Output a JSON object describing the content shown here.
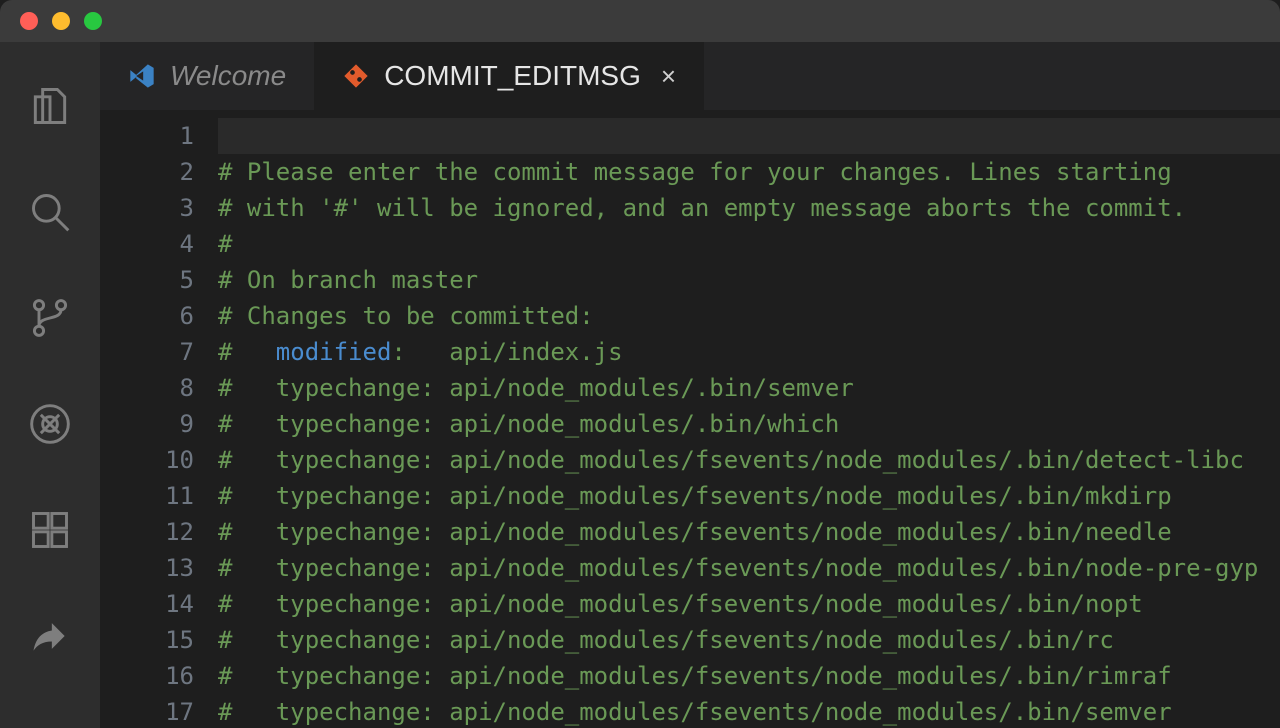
{
  "tabs": {
    "welcome": {
      "label": "Welcome"
    },
    "commit": {
      "label": "COMMIT_EDITMSG",
      "close": "×"
    }
  },
  "lineNumbers": [
    "1",
    "2",
    "3",
    "4",
    "5",
    "6",
    "7",
    "8",
    "9",
    "10",
    "11",
    "12",
    "13",
    "14",
    "15",
    "16",
    "17"
  ],
  "lines": [
    {
      "segments": [
        {
          "cls": "tok-default",
          "text": ""
        }
      ],
      "cursor": true
    },
    {
      "segments": [
        {
          "cls": "tok-comment",
          "text": "# Please enter the commit message for your changes. Lines starting"
        }
      ]
    },
    {
      "segments": [
        {
          "cls": "tok-comment",
          "text": "# with '#' will be ignored, and an empty message aborts the commit."
        }
      ]
    },
    {
      "segments": [
        {
          "cls": "tok-comment",
          "text": "#"
        }
      ]
    },
    {
      "segments": [
        {
          "cls": "tok-comment",
          "text": "# On branch master"
        }
      ]
    },
    {
      "segments": [
        {
          "cls": "tok-comment",
          "text": "# Changes to be committed:"
        }
      ]
    },
    {
      "segments": [
        {
          "cls": "tok-comment",
          "text": "#   "
        },
        {
          "cls": "tok-keyword",
          "text": "modified"
        },
        {
          "cls": "tok-comment",
          "text": ":   api/index.js"
        }
      ]
    },
    {
      "segments": [
        {
          "cls": "tok-comment",
          "text": "#   typechange: api/node_modules/.bin/semver"
        }
      ]
    },
    {
      "segments": [
        {
          "cls": "tok-comment",
          "text": "#   typechange: api/node_modules/.bin/which"
        }
      ]
    },
    {
      "segments": [
        {
          "cls": "tok-comment",
          "text": "#   typechange: api/node_modules/fsevents/node_modules/.bin/detect-libc"
        }
      ]
    },
    {
      "segments": [
        {
          "cls": "tok-comment",
          "text": "#   typechange: api/node_modules/fsevents/node_modules/.bin/mkdirp"
        }
      ]
    },
    {
      "segments": [
        {
          "cls": "tok-comment",
          "text": "#   typechange: api/node_modules/fsevents/node_modules/.bin/needle"
        }
      ]
    },
    {
      "segments": [
        {
          "cls": "tok-comment",
          "text": "#   typechange: api/node_modules/fsevents/node_modules/.bin/node-pre-gyp"
        }
      ]
    },
    {
      "segments": [
        {
          "cls": "tok-comment",
          "text": "#   typechange: api/node_modules/fsevents/node_modules/.bin/nopt"
        }
      ]
    },
    {
      "segments": [
        {
          "cls": "tok-comment",
          "text": "#   typechange: api/node_modules/fsevents/node_modules/.bin/rc"
        }
      ]
    },
    {
      "segments": [
        {
          "cls": "tok-comment",
          "text": "#   typechange: api/node_modules/fsevents/node_modules/.bin/rimraf"
        }
      ]
    },
    {
      "segments": [
        {
          "cls": "tok-comment",
          "text": "#   typechange: api/node_modules/fsevents/node_modules/.bin/semver"
        }
      ]
    }
  ],
  "activity": {
    "explorer": "explorer-icon",
    "search": "search-icon",
    "scm": "source-control-icon",
    "debug": "debug-icon",
    "extensions": "extensions-icon",
    "share": "share-icon"
  }
}
